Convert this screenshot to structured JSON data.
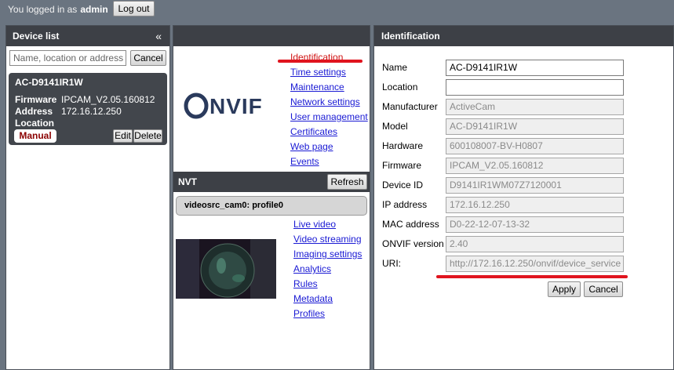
{
  "topbar": {
    "logged_in_as": "You logged in as",
    "user": "admin",
    "logout": "Log out"
  },
  "device_list": {
    "title": "Device list",
    "collapse_icon": "«",
    "search_placeholder": "Name, location or address",
    "cancel": "Cancel",
    "device": {
      "name": "AC-D9141IR1W",
      "firmware_label": "Firmware",
      "firmware": "IPCAM_V2.05.160812",
      "address_label": "Address",
      "address": "172.16.12.250",
      "location_label": "Location",
      "badge": "Manual",
      "edit": "Edit",
      "delete": "Delete"
    }
  },
  "middle": {
    "logo_text": "ONVIF",
    "menu": [
      "Identification",
      "Time settings",
      "Maintenance",
      "Network settings",
      "User management",
      "Certificates",
      "Web page",
      "Events"
    ],
    "nvt_title": "NVT",
    "refresh": "Refresh",
    "profile": "videosrc_cam0: profile0",
    "menu2": [
      "Live video",
      "Video streaming",
      "Imaging settings",
      "Analytics",
      "Rules",
      "Metadata",
      "Profiles"
    ]
  },
  "identification": {
    "title": "Identification",
    "fields": [
      {
        "label": "Name",
        "value": "AC-D9141IR1W",
        "editable": true
      },
      {
        "label": "Location",
        "value": "",
        "editable": true
      },
      {
        "label": "Manufacturer",
        "value": "ActiveCam",
        "editable": false
      },
      {
        "label": "Model",
        "value": "AC-D9141IR1W",
        "editable": false
      },
      {
        "label": "Hardware",
        "value": "600108007-BV-H0807",
        "editable": false
      },
      {
        "label": "Firmware",
        "value": "IPCAM_V2.05.160812",
        "editable": false
      },
      {
        "label": "Device ID",
        "value": "D9141IR1WM07Z7120001",
        "editable": false
      },
      {
        "label": "IP address",
        "value": "172.16.12.250",
        "editable": false
      },
      {
        "label": "MAC address",
        "value": "D0-22-12-07-13-32",
        "editable": false
      },
      {
        "label": "ONVIF version",
        "value": "2.40",
        "editable": false
      },
      {
        "label": "URI:",
        "value": "http://172.16.12.250/onvif/device_service",
        "editable": false
      }
    ],
    "apply": "Apply",
    "cancel": "Cancel"
  },
  "colors": {
    "header": "#3d4046",
    "link": "#1a1ad4",
    "active_link": "#d01515",
    "annotation": "#e0141e"
  }
}
